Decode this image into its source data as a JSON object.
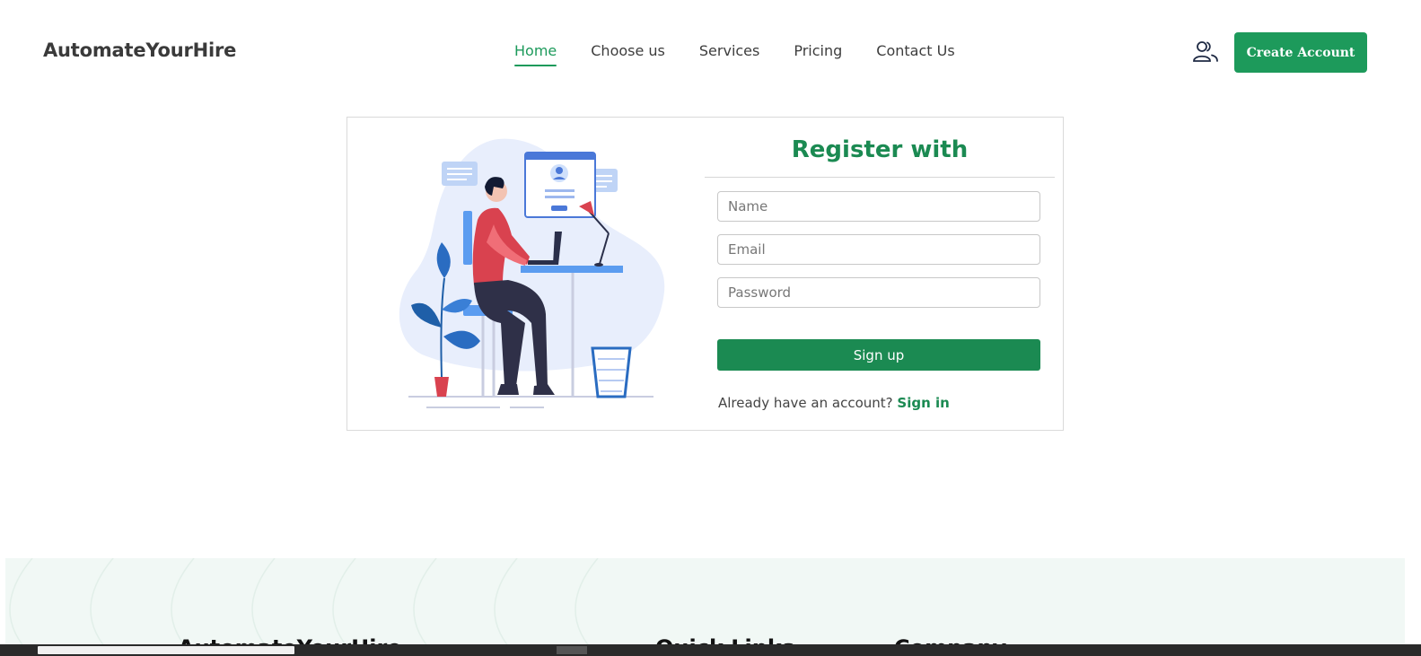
{
  "header": {
    "logo": "AutomateYourHire",
    "nav": [
      {
        "label": "Home",
        "active": true
      },
      {
        "label": "Choose us",
        "active": false
      },
      {
        "label": "Services",
        "active": false
      },
      {
        "label": "Pricing",
        "active": false
      },
      {
        "label": "Contact Us",
        "active": false
      }
    ],
    "user_icon": "users-icon",
    "create_account_label": "Create Account"
  },
  "register": {
    "title": "Register with",
    "name_placeholder": "Name",
    "email_placeholder": "Email",
    "password_placeholder": "Password",
    "signup_label": "Sign up",
    "have_account_text": "Already have an account?",
    "signin_label": "Sign in"
  },
  "footer": {
    "col1_title": "AutomateYourHire",
    "col2_title": "Quick Links",
    "col3_title": "Company"
  },
  "colors": {
    "brand_green": "#1d9a5b",
    "title_green": "#1b8a52",
    "footer_bg": "#f1f8f5"
  }
}
